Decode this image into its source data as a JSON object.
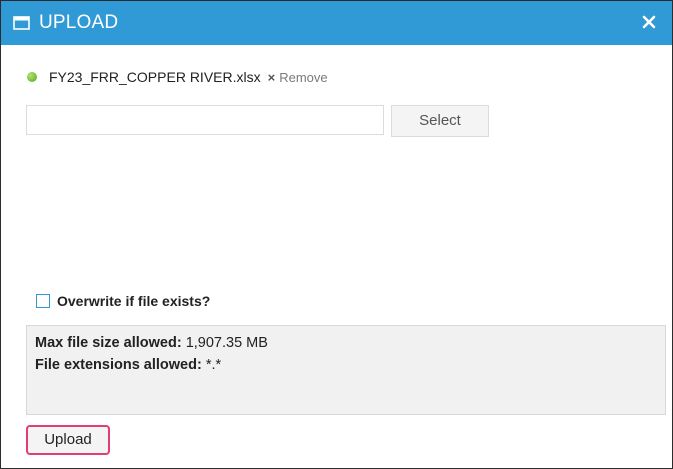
{
  "dialog": {
    "title": "UPLOAD",
    "close_icon": "close-icon",
    "window_icon": "window-icon"
  },
  "file": {
    "name": "FY23_FRR_COPPER RIVER.xlsx",
    "remove_symbol": "×",
    "remove_label": "Remove",
    "status_color": "#7cc33b"
  },
  "picker": {
    "input_value": "",
    "select_label": "Select"
  },
  "overwrite": {
    "label": "Overwrite if file exists?",
    "checked": false
  },
  "info": {
    "max_size_label": "Max file size allowed:",
    "max_size_value": "1,907.35 MB",
    "extensions_label": "File extensions allowed:",
    "extensions_value": "*.*"
  },
  "actions": {
    "upload_label": "Upload"
  },
  "colors": {
    "titlebar": "#2f9ad6",
    "highlight": "#e23d77"
  }
}
